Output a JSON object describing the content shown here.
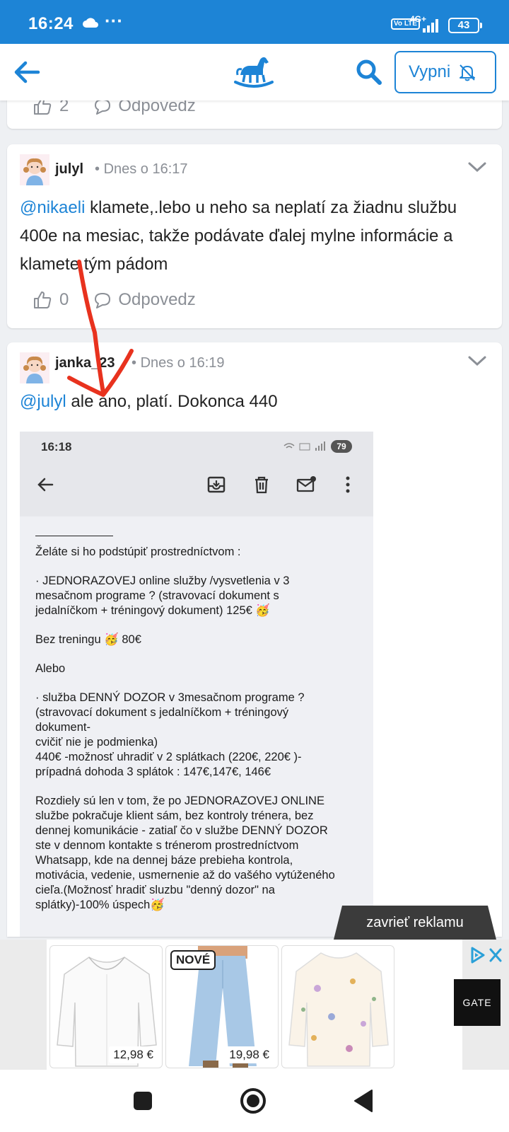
{
  "status_bar": {
    "time": "16:24",
    "dots": "···",
    "volte": "Vo LTE",
    "network": "4G+",
    "battery": "43"
  },
  "header": {
    "mute_button_label": "Vypni"
  },
  "comments": [
    {
      "likes": "2",
      "reply_label": "Odpovedz"
    },
    {
      "username": "julyl",
      "date": "Dnes o 16:17",
      "mention": "@nikaeli",
      "text": " klamete,.lebo u neho sa neplatí za žiadnu službu 400e na mesiac, takže podávate ďalej mylne informácie a klamete tým pádom",
      "likes": "0",
      "reply_label": "Odpovedz"
    },
    {
      "username": "janka_23",
      "date": "Dnes o 16:19",
      "mention": "@julyl",
      "text": " ale áno, platí. Dokonca 440"
    }
  ],
  "embedded_screenshot": {
    "time": "16:18",
    "battery": "79",
    "paragraphs": [
      "Želáte si ho podstúpiť prostredníctvom :",
      "· JEDNORAZOVEJ online služby /vysvetlenia v 3\nmesačnom programe ? (stravovací dokument s\njedalníčkom + tréningový dokument) 125€ 🥳",
      "Bez treningu 🥳 80€",
      "Alebo",
      "· služba DENNÝ DOZOR v 3mesačnom programe ?\n(stravovací dokument s jedalníčkom + tréningový\ndokument-\ncvičiť nie je podmienka)\n440€ -možnosť uhradiť v 2 splátkach (220€, 220€ )-\nprípadná dohoda 3 splátok : 147€,147€, 146€",
      "",
      "Rozdiely sú len v tom, že po JEDNORAZOVEJ ONLINE\nslužbe pokračuje klient sám, bez kontroly trénera, bez\ndennej komunikácie - zatiaľ čo v službe DENNÝ DOZOR\nste v dennom kontakte s trénerom prostredníctvom\nWhatsapp, kde na dennej báze prebieha kontrola,\nmotivácia, vedenie, usmernenie až do vašého vytúženého\ncieľa.(Možnosť hradiť sluzbu \"denný dozor\" na\nsplátky)-100% úspech🥳"
    ]
  },
  "ad": {
    "close_label": "zavrieť reklamu",
    "products": [
      {
        "price": "12,98 €"
      },
      {
        "badge": "NOVÉ",
        "price": "19,98 €"
      },
      {
        "price": ""
      }
    ],
    "brand": "GATE"
  },
  "colors": {
    "primary": "#1d84d6",
    "annotation_arrow": "#e8321e"
  }
}
